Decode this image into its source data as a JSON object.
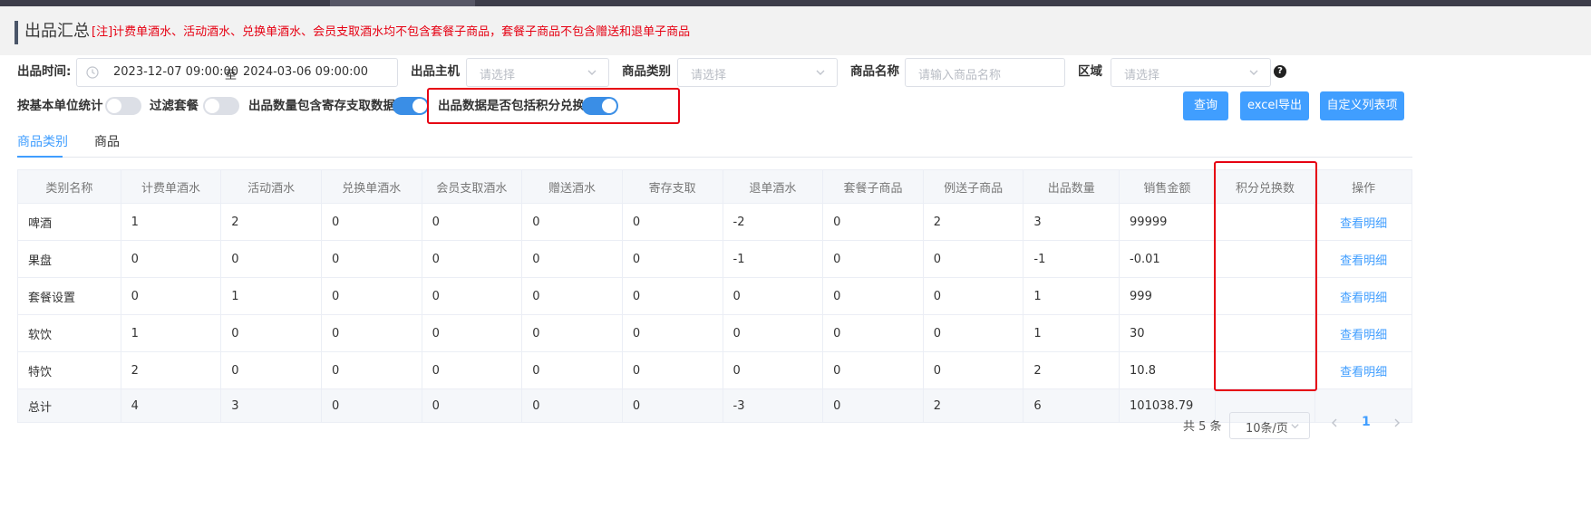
{
  "header": {
    "title": "出品汇总",
    "note": "[注]计费单酒水、活动酒水、兑换单酒水、会员支取酒水均不包含套餐子商品，套餐子商品不包含赠送和退单子商品"
  },
  "filters": {
    "time_label": "出品时间:",
    "date_start": "2023-12-07 09:00:00",
    "date_sep": "至",
    "date_end": "2024-03-06 09:00:00",
    "host_label": "出品主机",
    "host_placeholder": "请选择",
    "category_label": "商品类别",
    "category_placeholder": "请选择",
    "name_label": "商品名称",
    "name_placeholder": "请输入商品名称",
    "area_label": "区域",
    "area_placeholder": "请选择",
    "help_symbol": "?"
  },
  "toggles": [
    {
      "label": "按基本单位统计",
      "on": false
    },
    {
      "label": "过滤套餐",
      "on": false
    },
    {
      "label": "出品数量包含寄存支取数据",
      "on": true
    },
    {
      "label": "出品数据是否包括积分兑换",
      "on": true
    }
  ],
  "buttons": {
    "query": "查询",
    "export": "excel导出",
    "custom": "自定义列表项"
  },
  "tabs": [
    {
      "label": "商品类别",
      "active": true
    },
    {
      "label": "商品",
      "active": false
    }
  ],
  "table": {
    "columns": [
      "类别名称",
      "计费单酒水",
      "活动酒水",
      "兑换单酒水",
      "会员支取酒水",
      "赠送酒水",
      "寄存支取",
      "退单酒水",
      "套餐子商品",
      "例送子商品",
      "出品数量",
      "销售金额",
      "积分兑换数",
      "操作"
    ],
    "rows": [
      [
        "啤酒",
        "1",
        "2",
        "0",
        "0",
        "0",
        "0",
        "-2",
        "0",
        "2",
        "3",
        "99999",
        "",
        "查看明细"
      ],
      [
        "果盘",
        "0",
        "0",
        "0",
        "0",
        "0",
        "0",
        "-1",
        "0",
        "0",
        "-1",
        "-0.01",
        "",
        "查看明细"
      ],
      [
        "套餐设置",
        "0",
        "1",
        "0",
        "0",
        "0",
        "0",
        "0",
        "0",
        "0",
        "1",
        "999",
        "",
        "查看明细"
      ],
      [
        "软饮",
        "1",
        "0",
        "0",
        "0",
        "0",
        "0",
        "0",
        "0",
        "0",
        "1",
        "30",
        "",
        "查看明细"
      ],
      [
        "特饮",
        "2",
        "0",
        "0",
        "0",
        "0",
        "0",
        "0",
        "0",
        "0",
        "2",
        "10.8",
        "",
        "查看明细"
      ]
    ],
    "total": [
      "总计",
      "4",
      "3",
      "0",
      "0",
      "0",
      "0",
      "-3",
      "0",
      "2",
      "6",
      "101038.79",
      "",
      ""
    ]
  },
  "pagination": {
    "total_text": "共 5 条",
    "page_size": "10条/页",
    "current_page": "1"
  },
  "colors": {
    "accent": "#409eff",
    "highlight": "#e60012"
  }
}
